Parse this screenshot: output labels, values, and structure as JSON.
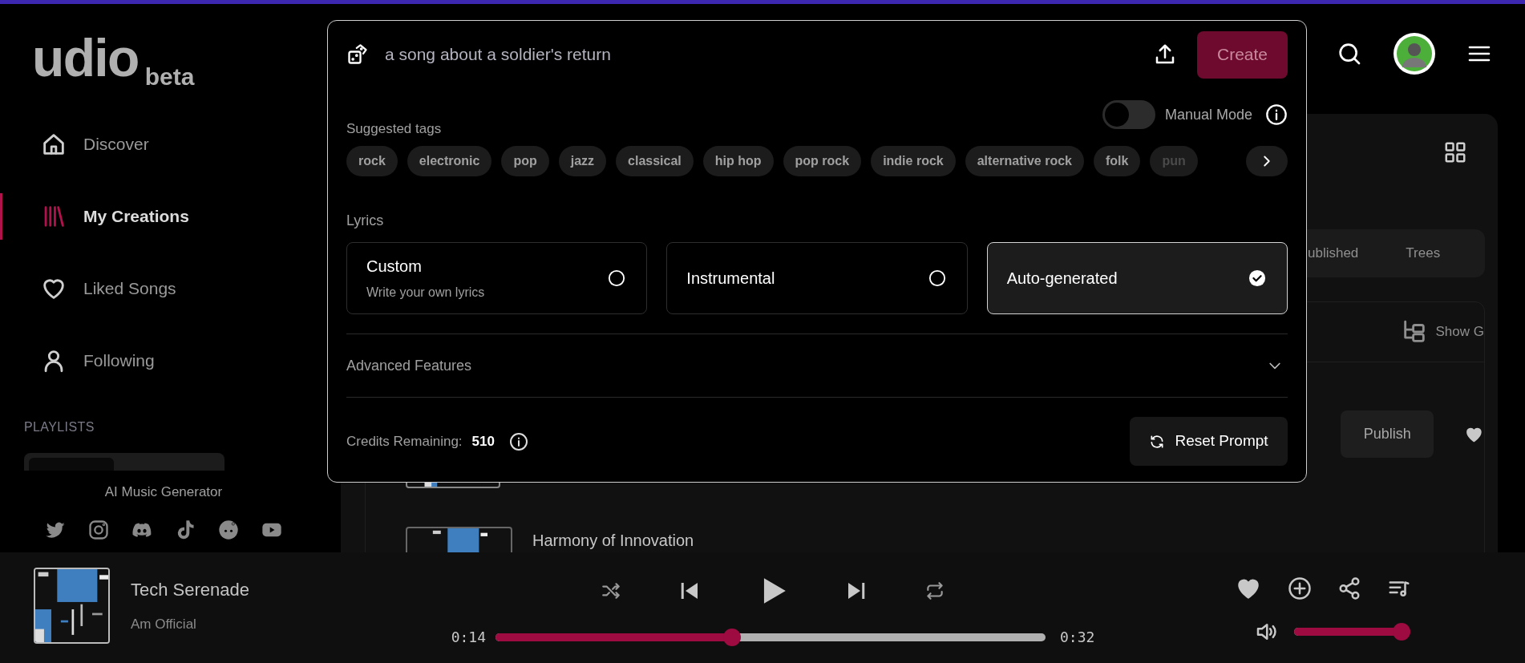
{
  "sidebar": {
    "logo": {
      "wordmark": "udio",
      "badge": "beta"
    },
    "nav": [
      {
        "label": "Discover",
        "selected": false
      },
      {
        "label": "My Creations",
        "selected": true
      },
      {
        "label": "Liked Songs",
        "selected": false
      },
      {
        "label": "Following",
        "selected": false
      }
    ],
    "playlists_heading": "PLAYLISTS",
    "tagline": "AI Music Generator"
  },
  "library": {
    "tabs": [
      {
        "label": "ublished",
        "selected": false
      },
      {
        "label": "Trees",
        "selected": false
      }
    ],
    "show_button": "Show G",
    "songs": [
      {
        "action": "Publish"
      },
      {
        "title": "Harmony of Innovation"
      }
    ]
  },
  "create_panel": {
    "prompt": {
      "value": "a song about a soldier's return"
    },
    "create_button": "Create",
    "manual_mode": {
      "label": "Manual Mode",
      "on": false
    },
    "tags_heading": "Suggested tags",
    "tags": [
      "rock",
      "electronic",
      "pop",
      "jazz",
      "classical",
      "hip hop",
      "pop rock",
      "indie rock",
      "alternative rock",
      "folk",
      "pun"
    ],
    "lyrics_heading": "Lyrics",
    "lyrics_options": [
      {
        "title": "Custom",
        "subtitle": "Write your own lyrics",
        "selected": false
      },
      {
        "title": "Instrumental",
        "selected": false
      },
      {
        "title": "Auto-generated",
        "selected": true
      }
    ],
    "advanced": {
      "label": "Advanced Features",
      "expanded": false
    },
    "credits": {
      "label": "Credits Remaining:",
      "value": "510"
    },
    "reset_button": "Reset Prompt"
  },
  "player": {
    "title": "Tech Serenade",
    "artist": "Am Official",
    "elapsed": "0:14",
    "duration": "0:32",
    "progress": {
      "level": 0.43
    },
    "volume": {
      "level": 0.97
    }
  }
}
